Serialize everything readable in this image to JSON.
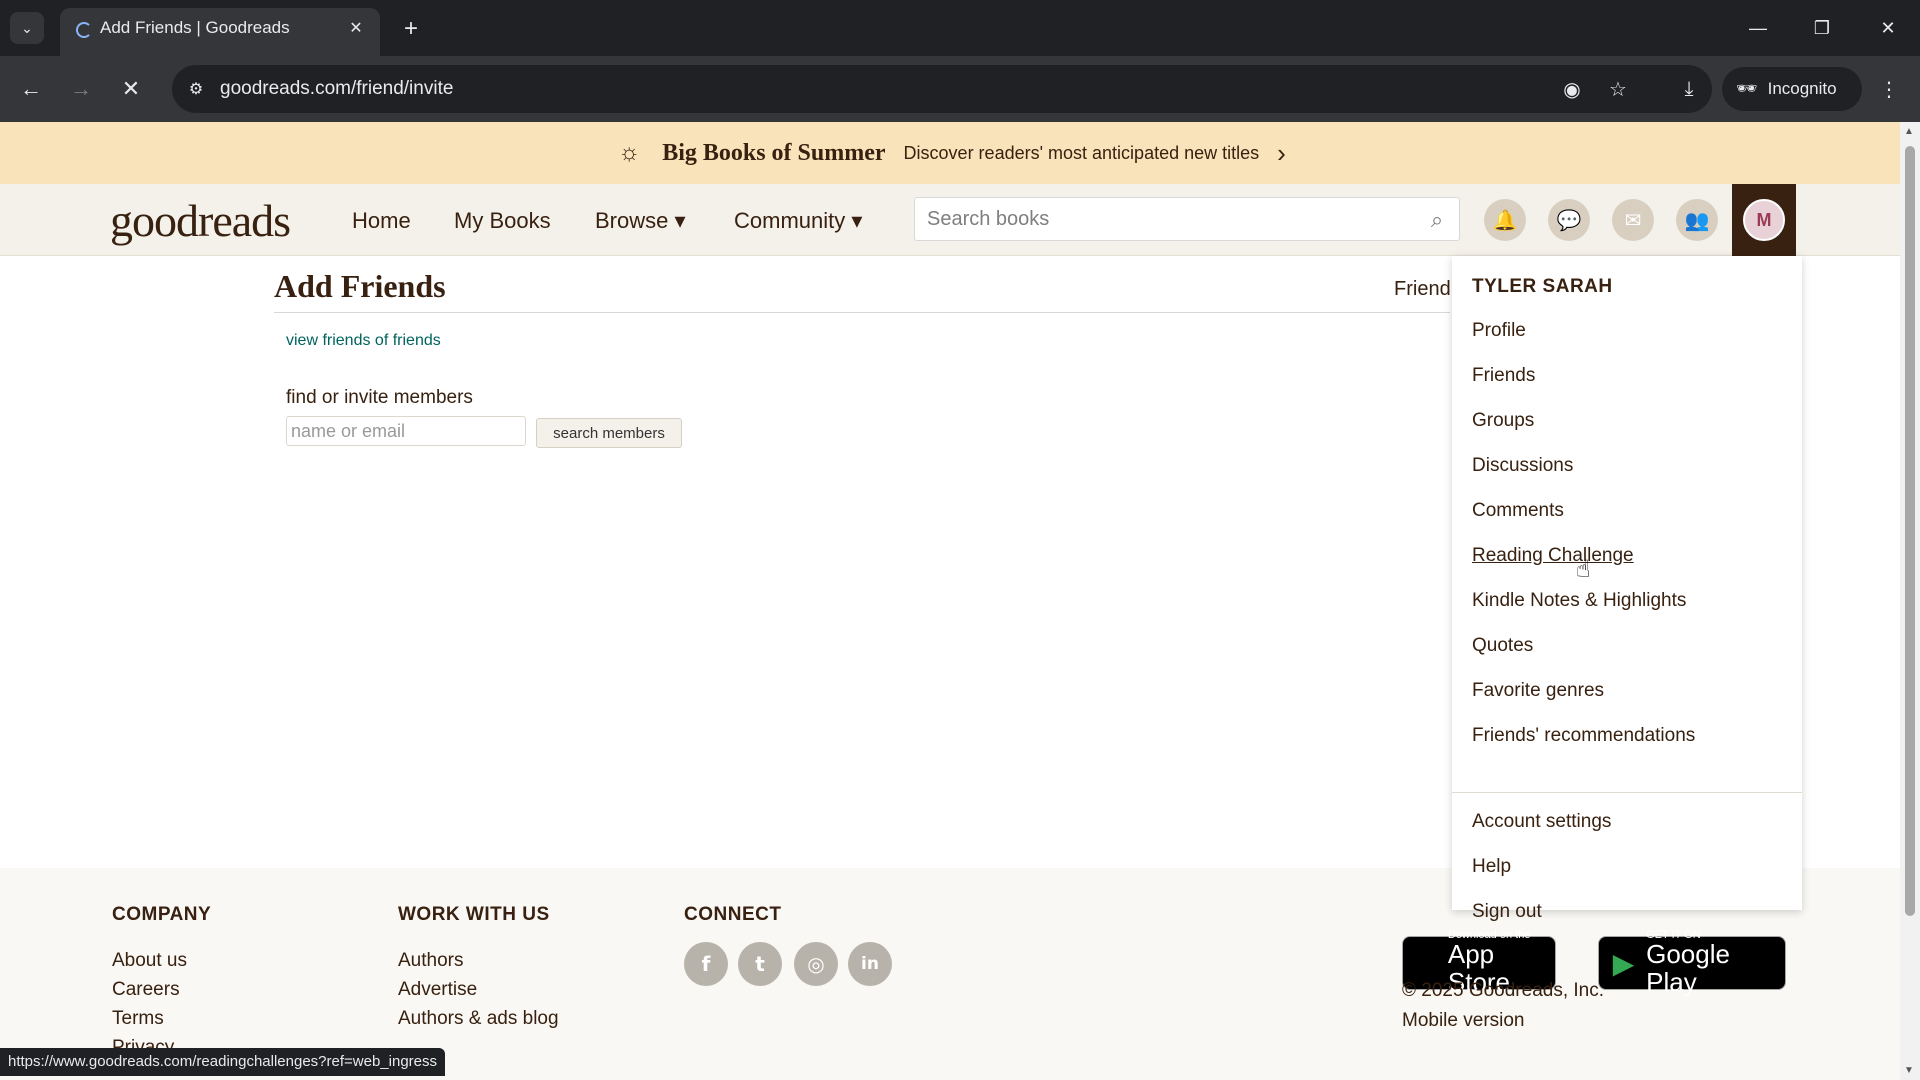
{
  "browser": {
    "tab_title": "Add Friends | Goodreads",
    "url": "goodreads.com/friend/invite",
    "incognito_label": "Incognito",
    "status_url": "https://www.goodreads.com/readingchallenges?ref=web_ingress"
  },
  "promo": {
    "title": "Big Books of Summer",
    "subtitle": "Discover readers' most anticipated new titles"
  },
  "header": {
    "logo": "goodreads",
    "nav": [
      "Home",
      "My Books",
      "Browse ▾",
      "Community ▾"
    ],
    "search_placeholder": "Search books",
    "avatar_initial": "M"
  },
  "main": {
    "title": "Add Friends",
    "friends_link": "Friend",
    "fof_link": "view friends of friends",
    "find_label": "find or invite members",
    "input_placeholder": "name or email",
    "search_button": "search members"
  },
  "dropdown": {
    "username": "TYLER SARAH",
    "items": [
      "Profile",
      "Friends",
      "Groups",
      "Discussions",
      "Comments",
      "Reading Challenge",
      "Kindle Notes & Highlights",
      "Quotes",
      "Favorite genres",
      "Friends' recommendations"
    ],
    "settings_items": [
      "Account settings",
      "Help",
      "Sign out"
    ]
  },
  "footer": {
    "company_heading": "COMPANY",
    "company_links": [
      "About us",
      "Careers",
      "Terms",
      "Privacy"
    ],
    "work_heading": "WORK WITH US",
    "work_links": [
      "Authors",
      "Advertise",
      "Authors & ads blog"
    ],
    "connect_heading": "CONNECT",
    "social": [
      "f",
      "t",
      "◎",
      "in"
    ],
    "app_store_small": "Download on the",
    "app_store_big": "App Store",
    "google_small": "GET IT ON",
    "google_big": "Google Play",
    "copyright": "© 2025 Goodreads, Inc.",
    "mobile_version": "Mobile version"
  },
  "colors": {
    "brand_brown": "#382110",
    "link_teal": "#00635d",
    "header_bg": "#f4f1ea",
    "promo_bg": "#f9e3bb"
  }
}
